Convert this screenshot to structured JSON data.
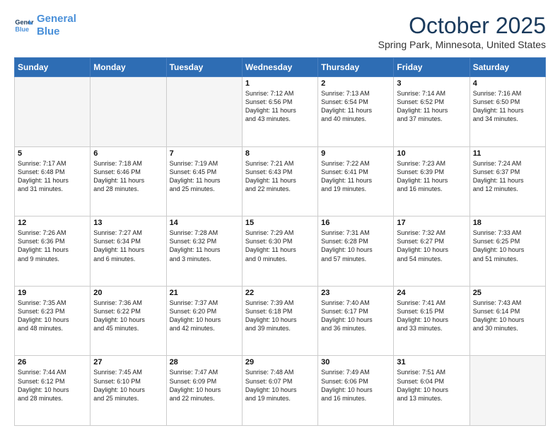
{
  "header": {
    "logo_line1": "General",
    "logo_line2": "Blue",
    "month": "October 2025",
    "location": "Spring Park, Minnesota, United States"
  },
  "days_of_week": [
    "Sunday",
    "Monday",
    "Tuesday",
    "Wednesday",
    "Thursday",
    "Friday",
    "Saturday"
  ],
  "weeks": [
    [
      {
        "day": "",
        "info": ""
      },
      {
        "day": "",
        "info": ""
      },
      {
        "day": "",
        "info": ""
      },
      {
        "day": "1",
        "info": "Sunrise: 7:12 AM\nSunset: 6:56 PM\nDaylight: 11 hours\nand 43 minutes."
      },
      {
        "day": "2",
        "info": "Sunrise: 7:13 AM\nSunset: 6:54 PM\nDaylight: 11 hours\nand 40 minutes."
      },
      {
        "day": "3",
        "info": "Sunrise: 7:14 AM\nSunset: 6:52 PM\nDaylight: 11 hours\nand 37 minutes."
      },
      {
        "day": "4",
        "info": "Sunrise: 7:16 AM\nSunset: 6:50 PM\nDaylight: 11 hours\nand 34 minutes."
      }
    ],
    [
      {
        "day": "5",
        "info": "Sunrise: 7:17 AM\nSunset: 6:48 PM\nDaylight: 11 hours\nand 31 minutes."
      },
      {
        "day": "6",
        "info": "Sunrise: 7:18 AM\nSunset: 6:46 PM\nDaylight: 11 hours\nand 28 minutes."
      },
      {
        "day": "7",
        "info": "Sunrise: 7:19 AM\nSunset: 6:45 PM\nDaylight: 11 hours\nand 25 minutes."
      },
      {
        "day": "8",
        "info": "Sunrise: 7:21 AM\nSunset: 6:43 PM\nDaylight: 11 hours\nand 22 minutes."
      },
      {
        "day": "9",
        "info": "Sunrise: 7:22 AM\nSunset: 6:41 PM\nDaylight: 11 hours\nand 19 minutes."
      },
      {
        "day": "10",
        "info": "Sunrise: 7:23 AM\nSunset: 6:39 PM\nDaylight: 11 hours\nand 16 minutes."
      },
      {
        "day": "11",
        "info": "Sunrise: 7:24 AM\nSunset: 6:37 PM\nDaylight: 11 hours\nand 12 minutes."
      }
    ],
    [
      {
        "day": "12",
        "info": "Sunrise: 7:26 AM\nSunset: 6:36 PM\nDaylight: 11 hours\nand 9 minutes."
      },
      {
        "day": "13",
        "info": "Sunrise: 7:27 AM\nSunset: 6:34 PM\nDaylight: 11 hours\nand 6 minutes."
      },
      {
        "day": "14",
        "info": "Sunrise: 7:28 AM\nSunset: 6:32 PM\nDaylight: 11 hours\nand 3 minutes."
      },
      {
        "day": "15",
        "info": "Sunrise: 7:29 AM\nSunset: 6:30 PM\nDaylight: 11 hours\nand 0 minutes."
      },
      {
        "day": "16",
        "info": "Sunrise: 7:31 AM\nSunset: 6:28 PM\nDaylight: 10 hours\nand 57 minutes."
      },
      {
        "day": "17",
        "info": "Sunrise: 7:32 AM\nSunset: 6:27 PM\nDaylight: 10 hours\nand 54 minutes."
      },
      {
        "day": "18",
        "info": "Sunrise: 7:33 AM\nSunset: 6:25 PM\nDaylight: 10 hours\nand 51 minutes."
      }
    ],
    [
      {
        "day": "19",
        "info": "Sunrise: 7:35 AM\nSunset: 6:23 PM\nDaylight: 10 hours\nand 48 minutes."
      },
      {
        "day": "20",
        "info": "Sunrise: 7:36 AM\nSunset: 6:22 PM\nDaylight: 10 hours\nand 45 minutes."
      },
      {
        "day": "21",
        "info": "Sunrise: 7:37 AM\nSunset: 6:20 PM\nDaylight: 10 hours\nand 42 minutes."
      },
      {
        "day": "22",
        "info": "Sunrise: 7:39 AM\nSunset: 6:18 PM\nDaylight: 10 hours\nand 39 minutes."
      },
      {
        "day": "23",
        "info": "Sunrise: 7:40 AM\nSunset: 6:17 PM\nDaylight: 10 hours\nand 36 minutes."
      },
      {
        "day": "24",
        "info": "Sunrise: 7:41 AM\nSunset: 6:15 PM\nDaylight: 10 hours\nand 33 minutes."
      },
      {
        "day": "25",
        "info": "Sunrise: 7:43 AM\nSunset: 6:14 PM\nDaylight: 10 hours\nand 30 minutes."
      }
    ],
    [
      {
        "day": "26",
        "info": "Sunrise: 7:44 AM\nSunset: 6:12 PM\nDaylight: 10 hours\nand 28 minutes."
      },
      {
        "day": "27",
        "info": "Sunrise: 7:45 AM\nSunset: 6:10 PM\nDaylight: 10 hours\nand 25 minutes."
      },
      {
        "day": "28",
        "info": "Sunrise: 7:47 AM\nSunset: 6:09 PM\nDaylight: 10 hours\nand 22 minutes."
      },
      {
        "day": "29",
        "info": "Sunrise: 7:48 AM\nSunset: 6:07 PM\nDaylight: 10 hours\nand 19 minutes."
      },
      {
        "day": "30",
        "info": "Sunrise: 7:49 AM\nSunset: 6:06 PM\nDaylight: 10 hours\nand 16 minutes."
      },
      {
        "day": "31",
        "info": "Sunrise: 7:51 AM\nSunset: 6:04 PM\nDaylight: 10 hours\nand 13 minutes."
      },
      {
        "day": "",
        "info": ""
      }
    ]
  ]
}
